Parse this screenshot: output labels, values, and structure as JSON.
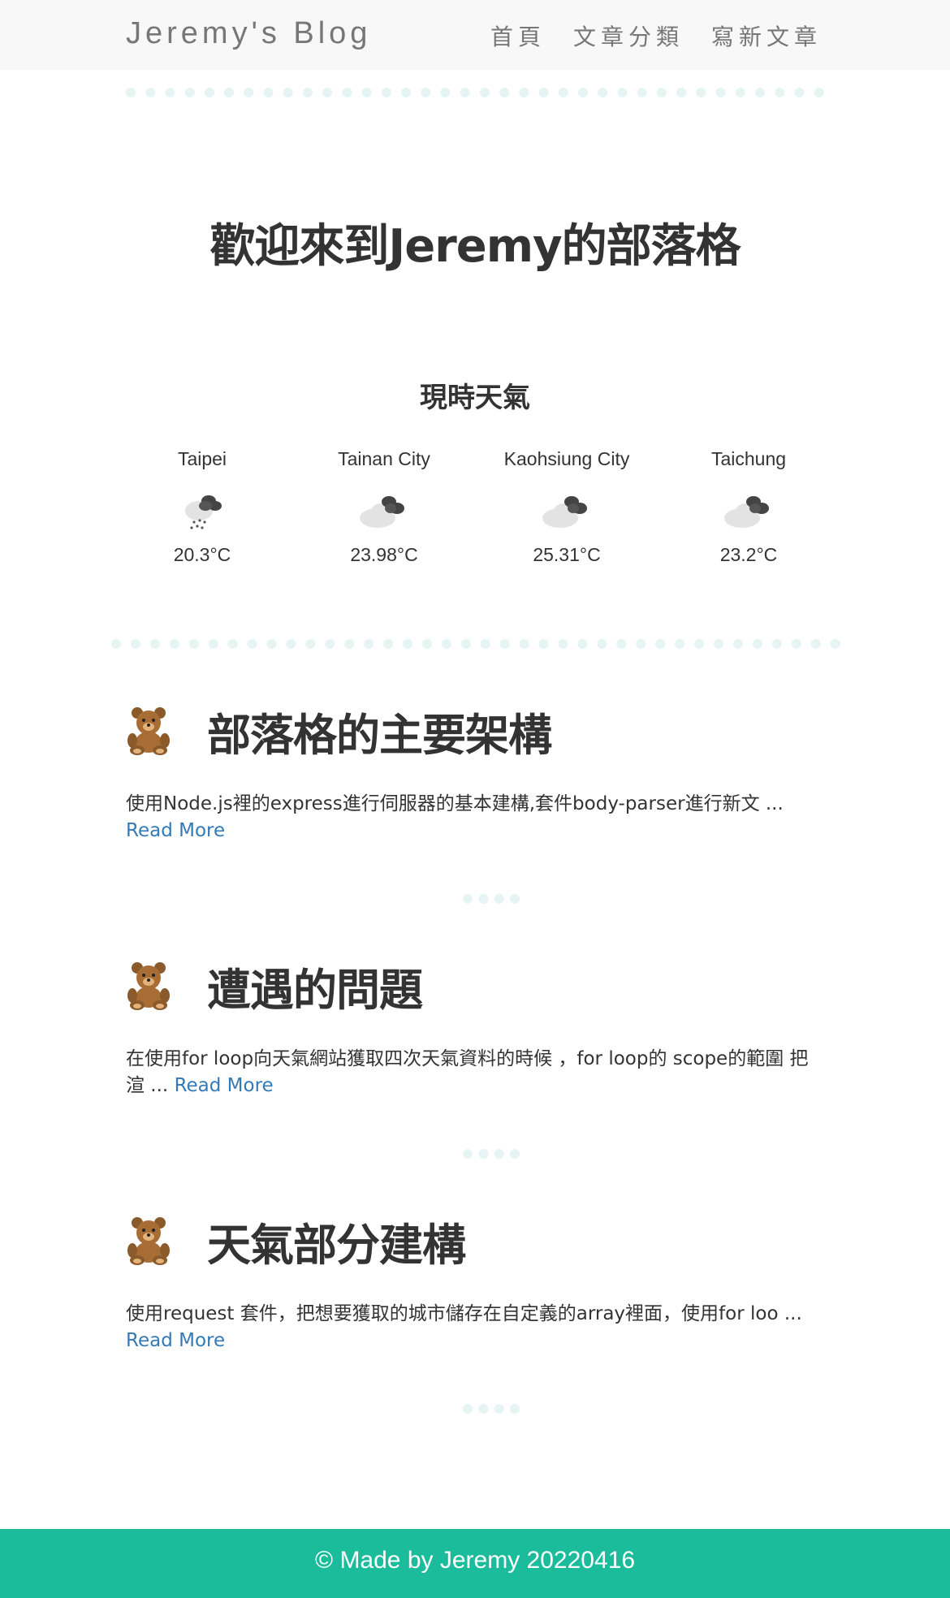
{
  "nav": {
    "brand": "Jeremy's Blog",
    "links": [
      "首頁",
      "文章分類",
      "寫新文章"
    ]
  },
  "hero": {
    "title": "歡迎來到Jeremy的部落格"
  },
  "weather": {
    "title": "現時天氣",
    "cities": [
      {
        "name": "Taipei",
        "temp": "20.3°C",
        "icon": "rain-cloud-icon"
      },
      {
        "name": "Tainan City",
        "temp": "23.98°C",
        "icon": "cloudy-icon"
      },
      {
        "name": "Kaohsiung City",
        "temp": "25.31°C",
        "icon": "cloudy-icon"
      },
      {
        "name": "Taichung",
        "temp": "23.2°C",
        "icon": "cloudy-icon"
      }
    ]
  },
  "posts": [
    {
      "title": "部落格的主要架構",
      "excerpt": "使用Node.js裡的express進行伺服器的基本建構,套件body-parser進行新文 ...",
      "read_more": "Read More"
    },
    {
      "title": "遭遇的問題",
      "excerpt": "在使用for loop向天氣網站獲取四次天氣資料的時候 ，for loop的 scope的範圍 把渲 ...",
      "read_more": "Read More"
    },
    {
      "title": "天氣部分建構",
      "excerpt": "使用request 套件，把想要獲取的城市儲存在自定義的array裡面，使用for loo ...",
      "read_more": "Read More"
    }
  ],
  "footer": {
    "text": "© Made by Jeremy 20220416"
  },
  "colors": {
    "accent": "#1abc9c",
    "link": "#337ab7",
    "divider": "#e6f4f4"
  }
}
